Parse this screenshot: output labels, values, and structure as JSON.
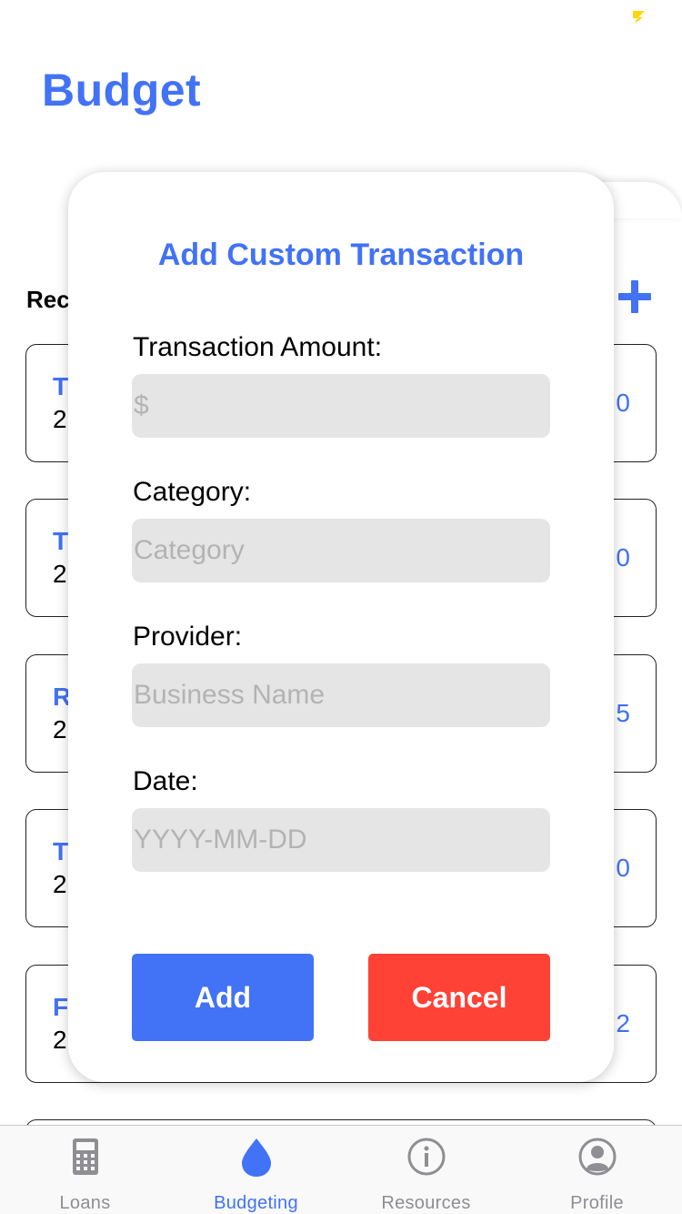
{
  "status": {
    "indicator_icon": "yellow-lightning-icon",
    "color": "#ffd60a"
  },
  "header": {
    "title": "Budget"
  },
  "recent": {
    "label": "Rec",
    "add_icon": "plus-icon",
    "transactions": [
      {
        "name": "T",
        "date": "2",
        "amount": "0"
      },
      {
        "name": "T",
        "date": "2",
        "amount": "0"
      },
      {
        "name": "R",
        "date": "2",
        "amount": "5"
      },
      {
        "name": "T",
        "date": "2",
        "amount": "0"
      },
      {
        "name": "F",
        "date": "2",
        "amount": "2"
      }
    ]
  },
  "modal": {
    "title": "Add Custom Transaction",
    "amount": {
      "label": "Transaction Amount:",
      "placeholder": "$",
      "value": ""
    },
    "category": {
      "label": "Category:",
      "placeholder": "Category",
      "value": ""
    },
    "provider": {
      "label": "Provider:",
      "placeholder": "Business Name",
      "value": ""
    },
    "date": {
      "label": "Date:",
      "placeholder": "YYYY-MM-DD",
      "value": ""
    },
    "add_label": "Add",
    "cancel_label": "Cancel"
  },
  "tabbar": {
    "tabs": [
      {
        "label": "Loans",
        "icon": "calculator-icon",
        "active": false
      },
      {
        "label": "Budgeting",
        "icon": "drop-icon",
        "active": true
      },
      {
        "label": "Resources",
        "icon": "info-icon",
        "active": false
      },
      {
        "label": "Profile",
        "icon": "person-icon",
        "active": false
      }
    ]
  },
  "colors": {
    "accent": "#4272f5",
    "danger": "#ff4136",
    "input_bg": "#e5e5e5",
    "inactive_tab": "#8e8e93"
  }
}
